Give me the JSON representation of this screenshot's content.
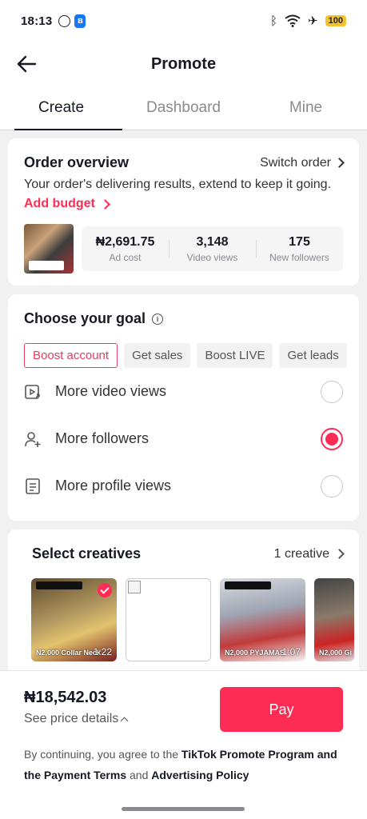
{
  "status_bar": {
    "time": "18:13",
    "battery": "100"
  },
  "header": {
    "title": "Promote"
  },
  "tabs": [
    {
      "label": "Create",
      "active": true
    },
    {
      "label": "Dashboard",
      "active": false
    },
    {
      "label": "Mine",
      "active": false
    }
  ],
  "order": {
    "title": "Order overview",
    "switch_label": "Switch order",
    "description": "Your order's delivering results, extend to keep it going.",
    "add_budget": "Add budget",
    "stats": [
      {
        "value": "₦2,691.75",
        "label": "Ad cost"
      },
      {
        "value": "3,148",
        "label": "Video views"
      },
      {
        "value": "175",
        "label": "New followers"
      }
    ]
  },
  "goal": {
    "title": "Choose your goal",
    "chips": [
      {
        "label": "Boost account",
        "selected": true
      },
      {
        "label": "Get sales",
        "selected": false
      },
      {
        "label": "Boost LIVE",
        "selected": false
      },
      {
        "label": "Get leads",
        "selected": false
      }
    ],
    "options": [
      {
        "label": "More video views",
        "icon": "video-play-icon",
        "selected": false
      },
      {
        "label": "More followers",
        "icon": "add-person-icon",
        "selected": true
      },
      {
        "label": "More profile views",
        "icon": "document-icon",
        "selected": false
      }
    ]
  },
  "creatives": {
    "title": "Select creatives",
    "count_label": "1 creative",
    "items": [
      {
        "caption": "N2,000 Collar Neck",
        "duration": "1:22",
        "selected": true
      },
      {
        "caption": "",
        "duration": "",
        "selected": false
      },
      {
        "caption": "N2,000 PYJAMAS",
        "duration": "1:07",
        "selected": false
      },
      {
        "caption": "N2,000 Gi",
        "duration": "",
        "selected": false
      }
    ]
  },
  "checkout": {
    "total": "₦18,542.03",
    "price_details": "See price details",
    "pay_label": "Pay",
    "terms_prefix": "By continuing, you agree to the ",
    "terms_link1": "TikTok Promote Program and the Payment Terms",
    "terms_and": " and ",
    "terms_link2": "Advertising Policy"
  },
  "colors": {
    "accent": "#fe2c55",
    "text": "#161823",
    "muted": "#8a8b91",
    "background": "#f1f1f2"
  }
}
